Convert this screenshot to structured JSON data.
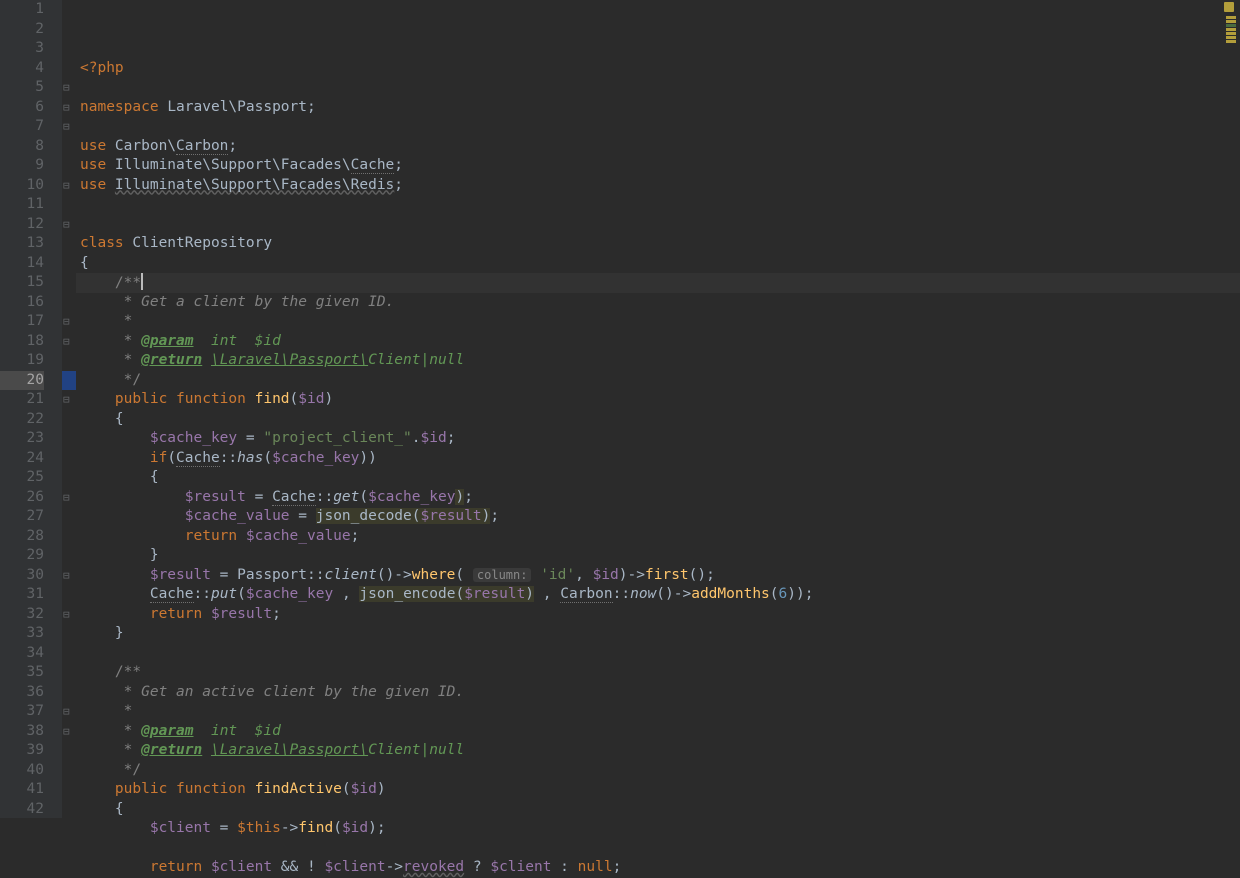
{
  "startLine": 1,
  "endLine": 42,
  "highlightedLine": 12,
  "gutterSelLine": 20,
  "lines": {
    "l1": [
      {
        "t": "<?php",
        "c": "kw"
      }
    ],
    "l2": [],
    "l3": [
      {
        "t": "namespace ",
        "c": "kw"
      },
      {
        "t": "Laravel\\Passport;",
        "c": "cls"
      }
    ],
    "l4": [],
    "l5": [
      {
        "t": "use ",
        "c": "kw"
      },
      {
        "t": "Carbon\\",
        "c": "cls"
      },
      {
        "t": "Carbon",
        "c": "cls dotted"
      },
      {
        "t": ";",
        "c": "cls"
      }
    ],
    "l6": [
      {
        "t": "use ",
        "c": "kw"
      },
      {
        "t": "Illuminate\\Support\\Facades\\",
        "c": "cls"
      },
      {
        "t": "Cache",
        "c": "cls dotted"
      },
      {
        "t": ";",
        "c": "cls"
      }
    ],
    "l7": [
      {
        "t": "use ",
        "c": "kw"
      },
      {
        "t": "Illuminate\\Support\\Facades\\Redis",
        "c": "cls cls-u"
      },
      {
        "t": ";",
        "c": "cls"
      }
    ],
    "l8": [],
    "l9": [],
    "l10": [
      {
        "t": "class ",
        "c": "kw"
      },
      {
        "t": "ClientRepository",
        "c": "cls"
      }
    ],
    "l11": [
      {
        "t": "{",
        "c": "cls"
      }
    ],
    "l12": [
      {
        "t": "    ",
        "c": ""
      },
      {
        "t": "/**",
        "c": "cmt"
      }
    ],
    "l13": [
      {
        "t": "     ",
        "c": ""
      },
      {
        "t": "* ",
        "c": "cmt"
      },
      {
        "t": "Get a client by the given ID.",
        "c": "cmt-em"
      }
    ],
    "l14": [
      {
        "t": "     ",
        "c": ""
      },
      {
        "t": "*",
        "c": "cmt"
      }
    ],
    "l15": [
      {
        "t": "     ",
        "c": ""
      },
      {
        "t": "* ",
        "c": "cmt"
      },
      {
        "t": "@param",
        "c": "doc-tag"
      },
      {
        "t": "  int  $id",
        "c": "doc-type"
      }
    ],
    "l16": [
      {
        "t": "     ",
        "c": ""
      },
      {
        "t": "* ",
        "c": "cmt"
      },
      {
        "t": "@return",
        "c": "doc-tag"
      },
      {
        "t": " ",
        "c": ""
      },
      {
        "t": "\\Laravel\\Passport\\",
        "c": "doc-type-u"
      },
      {
        "t": "Client|null",
        "c": "doc-type"
      }
    ],
    "l17": [
      {
        "t": "     ",
        "c": ""
      },
      {
        "t": "*/",
        "c": "cmt"
      }
    ],
    "l18": [
      {
        "t": "    ",
        "c": ""
      },
      {
        "t": "public function ",
        "c": "kw"
      },
      {
        "t": "find",
        "c": "fn-def"
      },
      {
        "t": "(",
        "c": "cls"
      },
      {
        "t": "$id",
        "c": "var"
      },
      {
        "t": ")",
        "c": "cls"
      }
    ],
    "l19": [
      {
        "t": "    ",
        "c": ""
      },
      {
        "t": "{",
        "c": "cls"
      }
    ],
    "l20": [
      {
        "t": "        ",
        "c": ""
      },
      {
        "t": "$cache_key",
        "c": "var"
      },
      {
        "t": " = ",
        "c": "cls"
      },
      {
        "t": "\"project_client_\"",
        "c": "str"
      },
      {
        "t": ".",
        "c": "cls"
      },
      {
        "t": "$id",
        "c": "var"
      },
      {
        "t": ";",
        "c": "cls"
      }
    ],
    "l21": [
      {
        "t": "        ",
        "c": ""
      },
      {
        "t": "if",
        "c": "kw"
      },
      {
        "t": "(",
        "c": "cls"
      },
      {
        "t": "Cache",
        "c": "cls dotted"
      },
      {
        "t": "::",
        "c": "cls"
      },
      {
        "t": "has",
        "c": "ital static-it"
      },
      {
        "t": "(",
        "c": "cls"
      },
      {
        "t": "$cache_key",
        "c": "var"
      },
      {
        "t": "))",
        "c": "cls"
      }
    ],
    "l22": [
      {
        "t": "        ",
        "c": ""
      },
      {
        "t": "{",
        "c": "cls"
      }
    ],
    "l23": [
      {
        "t": "            ",
        "c": ""
      },
      {
        "t": "$result",
        "c": "var"
      },
      {
        "t": " = ",
        "c": "cls"
      },
      {
        "t": "Cache",
        "c": "cls dotted"
      },
      {
        "t": "::",
        "c": "cls"
      },
      {
        "t": "get",
        "c": "ital static-it"
      },
      {
        "t": "(",
        "c": "cls"
      },
      {
        "t": "$cache_key",
        "c": "var"
      },
      {
        "t": ")",
        "c": "cls warn-bg"
      },
      {
        "t": ";",
        "c": "cls"
      }
    ],
    "l24": [
      {
        "t": "            ",
        "c": ""
      },
      {
        "t": "$cache_value",
        "c": "var"
      },
      {
        "t": " = ",
        "c": "cls"
      },
      {
        "t": "json_decode(",
        "c": "cls warn-bg"
      },
      {
        "t": "$result",
        "c": "var warn-bg"
      },
      {
        "t": ")",
        "c": "cls warn-bg"
      },
      {
        "t": ";",
        "c": "cls"
      }
    ],
    "l25": [
      {
        "t": "            ",
        "c": ""
      },
      {
        "t": "return ",
        "c": "kw"
      },
      {
        "t": "$cache_value",
        "c": "var"
      },
      {
        "t": ";",
        "c": "cls"
      }
    ],
    "l26": [
      {
        "t": "        ",
        "c": ""
      },
      {
        "t": "}",
        "c": "cls"
      }
    ],
    "l27": [
      {
        "t": "        ",
        "c": ""
      },
      {
        "t": "$result",
        "c": "var"
      },
      {
        "t": " = Passport::",
        "c": "cls"
      },
      {
        "t": "client",
        "c": "ital static-it"
      },
      {
        "t": "()->",
        "c": "cls"
      },
      {
        "t": "where",
        "c": "fn-def"
      },
      {
        "t": "( ",
        "c": "cls"
      },
      {
        "t": "column:",
        "c": "hint"
      },
      {
        "t": " ",
        "c": ""
      },
      {
        "t": "'id'",
        "c": "str"
      },
      {
        "t": ", ",
        "c": "cls"
      },
      {
        "t": "$id",
        "c": "var"
      },
      {
        "t": ")->",
        "c": "cls"
      },
      {
        "t": "first",
        "c": "fn-def"
      },
      {
        "t": "();",
        "c": "cls"
      }
    ],
    "l28": [
      {
        "t": "        ",
        "c": ""
      },
      {
        "t": "Cache",
        "c": "cls dotted"
      },
      {
        "t": "::",
        "c": "cls"
      },
      {
        "t": "put",
        "c": "ital static-it"
      },
      {
        "t": "(",
        "c": "cls"
      },
      {
        "t": "$cache_key",
        "c": "var"
      },
      {
        "t": " , ",
        "c": "cls"
      },
      {
        "t": "json_encode(",
        "c": "cls warn-bg"
      },
      {
        "t": "$result",
        "c": "var warn-bg"
      },
      {
        "t": ")",
        "c": "cls warn-bg"
      },
      {
        "t": " , ",
        "c": "cls"
      },
      {
        "t": "Carbon",
        "c": "cls dotted"
      },
      {
        "t": "::",
        "c": "cls"
      },
      {
        "t": "now",
        "c": "ital static-it"
      },
      {
        "t": "()->",
        "c": "cls"
      },
      {
        "t": "addMonths",
        "c": "fn-def"
      },
      {
        "t": "(",
        "c": "cls"
      },
      {
        "t": "6",
        "c": "num"
      },
      {
        "t": "));",
        "c": "cls"
      }
    ],
    "l29": [
      {
        "t": "        ",
        "c": ""
      },
      {
        "t": "return ",
        "c": "kw"
      },
      {
        "t": "$result",
        "c": "var"
      },
      {
        "t": ";",
        "c": "cls"
      }
    ],
    "l30": [
      {
        "t": "    ",
        "c": ""
      },
      {
        "t": "}",
        "c": "cls"
      }
    ],
    "l31": [],
    "l32": [
      {
        "t": "    ",
        "c": ""
      },
      {
        "t": "/**",
        "c": "cmt"
      }
    ],
    "l33": [
      {
        "t": "     ",
        "c": ""
      },
      {
        "t": "* ",
        "c": "cmt"
      },
      {
        "t": "Get an active client by the given ID.",
        "c": "cmt-em"
      }
    ],
    "l34": [
      {
        "t": "     ",
        "c": ""
      },
      {
        "t": "*",
        "c": "cmt"
      }
    ],
    "l35": [
      {
        "t": "     ",
        "c": ""
      },
      {
        "t": "* ",
        "c": "cmt"
      },
      {
        "t": "@param",
        "c": "doc-tag"
      },
      {
        "t": "  int  $id",
        "c": "doc-type"
      }
    ],
    "l36": [
      {
        "t": "     ",
        "c": ""
      },
      {
        "t": "* ",
        "c": "cmt"
      },
      {
        "t": "@return",
        "c": "doc-tag"
      },
      {
        "t": " ",
        "c": ""
      },
      {
        "t": "\\Laravel\\Passport\\",
        "c": "doc-type-u"
      },
      {
        "t": "Client|null",
        "c": "doc-type"
      }
    ],
    "l37": [
      {
        "t": "     ",
        "c": ""
      },
      {
        "t": "*/",
        "c": "cmt"
      }
    ],
    "l38": [
      {
        "t": "    ",
        "c": ""
      },
      {
        "t": "public function ",
        "c": "kw"
      },
      {
        "t": "findActive",
        "c": "fn-def"
      },
      {
        "t": "(",
        "c": "cls"
      },
      {
        "t": "$id",
        "c": "var"
      },
      {
        "t": ")",
        "c": "cls"
      }
    ],
    "l39": [
      {
        "t": "    ",
        "c": ""
      },
      {
        "t": "{",
        "c": "cls"
      }
    ],
    "l40": [
      {
        "t": "        ",
        "c": ""
      },
      {
        "t": "$client",
        "c": "var"
      },
      {
        "t": " = ",
        "c": "cls"
      },
      {
        "t": "$this",
        "c": "kw"
      },
      {
        "t": "->",
        "c": "cls"
      },
      {
        "t": "find",
        "c": "fn-def"
      },
      {
        "t": "(",
        "c": "cls"
      },
      {
        "t": "$id",
        "c": "var"
      },
      {
        "t": ");",
        "c": "cls"
      }
    ],
    "l41": [],
    "l42": [
      {
        "t": "        ",
        "c": ""
      },
      {
        "t": "return ",
        "c": "kw"
      },
      {
        "t": "$client",
        "c": "var"
      },
      {
        "t": " && ! ",
        "c": "cls"
      },
      {
        "t": "$client",
        "c": "var"
      },
      {
        "t": "->",
        "c": "cls"
      },
      {
        "t": "revoked",
        "c": "var cls-u"
      },
      {
        "t": " ? ",
        "c": "cls"
      },
      {
        "t": "$client",
        "c": "var"
      },
      {
        "t": " : ",
        "c": "cls"
      },
      {
        "t": "null",
        "c": "kw"
      },
      {
        "t": ";",
        "c": "cls"
      }
    ]
  },
  "foldMarkers": [
    5,
    6,
    7,
    10,
    12,
    17,
    18,
    21,
    26,
    30,
    32,
    37,
    38
  ],
  "minimap": [
    "box",
    "warn",
    "warn",
    "ok",
    "warn",
    "warn",
    "warn",
    "warn"
  ]
}
